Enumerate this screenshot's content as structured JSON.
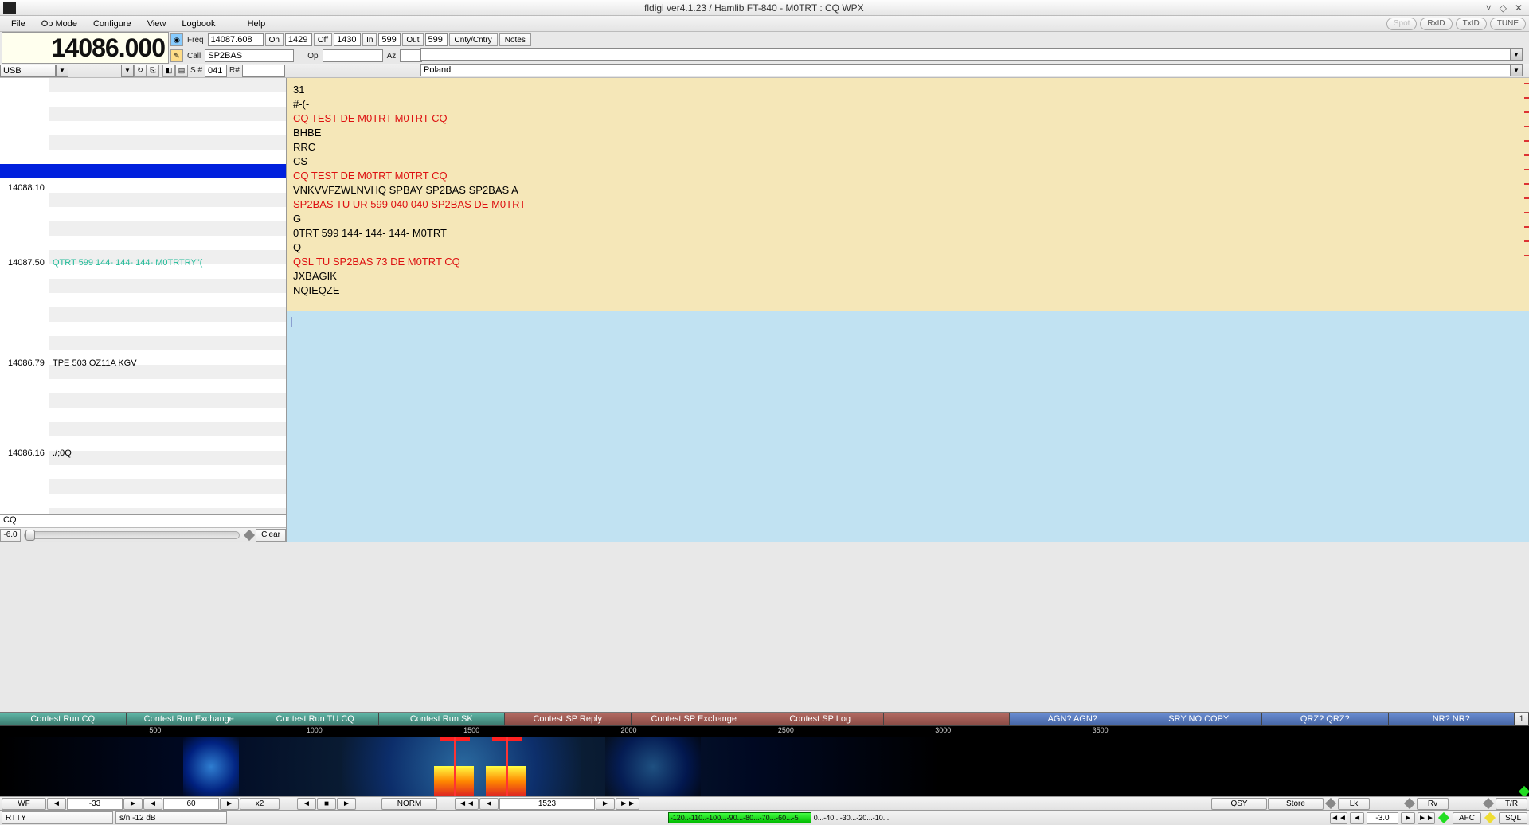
{
  "title": "fldigi ver4.1.23 / Hamlib FT-840 - M0TRT : CQ WPX",
  "menu": {
    "file": "File",
    "opmode": "Op Mode",
    "configure": "Configure",
    "view": "View",
    "logbook": "Logbook",
    "help": "Help"
  },
  "topbtns": {
    "spot": "Spot",
    "rxid": "RxID",
    "txid": "TxID",
    "tune": "TUNE"
  },
  "freq_display": "14086.000",
  "fields": {
    "freq_lbl": "Freq",
    "freq": "14087.608",
    "on_lbl": "On",
    "on": "1429",
    "off_lbl": "Off",
    "off": "1430",
    "in_lbl": "In",
    "in": "599",
    "out_lbl": "Out",
    "out": "599",
    "cnty_lbl": "Cnty/Cntry",
    "notes_lbl": "Notes",
    "call_lbl": "Call",
    "call": "SP2BAS",
    "op_lbl": "Op",
    "op": "",
    "az_lbl": "Az",
    "az": "",
    "mode": "USB",
    "snum_lbl": "S #",
    "snum": "041",
    "rnum_lbl": "R#",
    "rnum": "",
    "country": "Poland"
  },
  "spots": [
    {
      "freq": "14088.10",
      "text": ""
    },
    {
      "freq": "14087.50",
      "text": "QTRT 599  144- 144- 144- M0TRTRY\"(",
      "green": true
    },
    {
      "freq": "14086.79",
      "text": "TPE 503 OZ11A KGV"
    },
    {
      "freq": "14086.16",
      "text": "./;0Q"
    }
  ],
  "cq": "CQ",
  "slider_val": "-6.0",
  "clear": "Clear",
  "rx": [
    {
      "t": "31"
    },
    {
      "t": "#-(-"
    },
    {
      "t": "CQ TEST DE M0TRT  M0TRT  CQ",
      "red": true
    },
    {
      "t": "BHBE"
    },
    {
      "t": "RRC"
    },
    {
      "t": "CS"
    },
    {
      "t": "CQ TEST DE M0TRT  M0TRT  CQ",
      "red": true
    },
    {
      "t": "VNKVVFZWLNVHQ  SPBAY  SP2BAS   SP2BAS A"
    },
    {
      "t": "SP2BAS TU UR 599  040  040  SP2BAS DE M0TRT",
      "red": true
    },
    {
      "t": "G"
    },
    {
      "t": "0TRT 599  144- 144- 144- M0TRT"
    },
    {
      "t": "Q"
    },
    {
      "t": "QSL TU SP2BAS 73 DE M0TRT CQ",
      "red": true
    },
    {
      "t": "JXBAGIK"
    },
    {
      "t": "NQIEQZE"
    }
  ],
  "macros": {
    "g": [
      "Contest Run CQ",
      "Contest Run Exchange",
      "Contest Run TU CQ",
      "Contest Run SK"
    ],
    "r": [
      "Contest SP Reply",
      "Contest SP Exchange",
      "Contest SP Log",
      ""
    ],
    "b": [
      "AGN? AGN?",
      "SRY NO COPY",
      "QRZ? QRZ?",
      "NR? NR?"
    ],
    "num": "1"
  },
  "scale": [
    "500",
    "1000",
    "1500",
    "2000",
    "2500",
    "3000",
    "3500"
  ],
  "ctrl": {
    "wf": "WF",
    "v1": "-33",
    "v2": "60",
    "x2": "x2",
    "norm": "NORM",
    "cursor": "1523",
    "qsy": "QSY",
    "store": "Store",
    "lk": "Lk",
    "rv": "Rv",
    "tr": "T/R"
  },
  "status": {
    "mode": "RTTY",
    "sn": "s/n -12 dB",
    "bar": "-120..-110..-100...-90...-80...-70...-60...-5",
    "bar2": "0...-40...-30...-20...-10...",
    "v": "-3.0",
    "afc": "AFC",
    "sql": "SQL"
  }
}
